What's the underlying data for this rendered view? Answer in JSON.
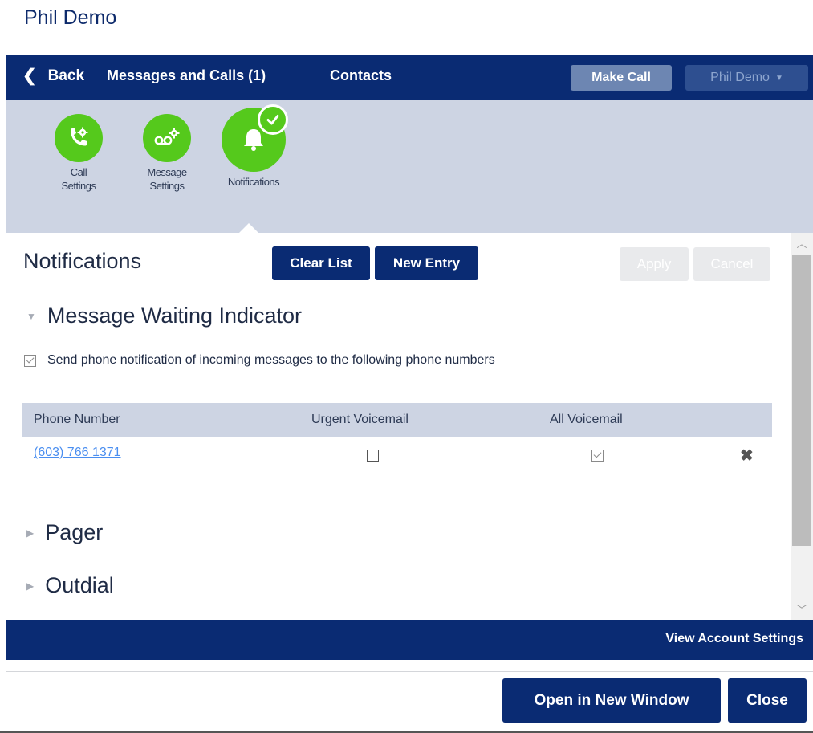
{
  "window": {
    "title": "Phil Demo"
  },
  "nav": {
    "back_label": "Back",
    "messages_calls_label": "Messages and Calls (1)",
    "contacts_label": "Contacts",
    "make_call_label": "Make Call",
    "user_menu_label": "Phil Demo"
  },
  "settings_icons": [
    {
      "label_line1": "Call",
      "label_line2": "Settings",
      "icon": "phone-gear-icon"
    },
    {
      "label_line1": "Message",
      "label_line2": "Settings",
      "icon": "voicemail-gear-icon"
    },
    {
      "label_line1": "Notifications",
      "label_line2": "",
      "icon": "bell-check-icon"
    }
  ],
  "notifications": {
    "title": "Notifications",
    "clear_list_label": "Clear List",
    "new_entry_label": "New Entry",
    "apply_label": "Apply",
    "cancel_label": "Cancel",
    "mwi": {
      "title": "Message Waiting Indicator",
      "expanded": true,
      "send_notification_checked": true,
      "send_notification_label": "Send phone notification of incoming messages to the following phone numbers",
      "columns": [
        "Phone Number",
        "Urgent Voicemail",
        "All Voicemail"
      ],
      "rows": [
        {
          "phone": "(603) 766 1371",
          "urgent_voicemail": false,
          "all_voicemail": true
        }
      ]
    },
    "pager_label": "Pager",
    "outdial_label": "Outdial"
  },
  "footer": {
    "view_account_settings_label": "View Account Settings",
    "open_new_window_label": "Open in New Window",
    "close_label": "Close"
  },
  "colors": {
    "navy": "#0a2b73",
    "accent_green": "#55c91c",
    "strip_bg": "#cdd4e3",
    "link_blue": "#4a8ef0"
  }
}
